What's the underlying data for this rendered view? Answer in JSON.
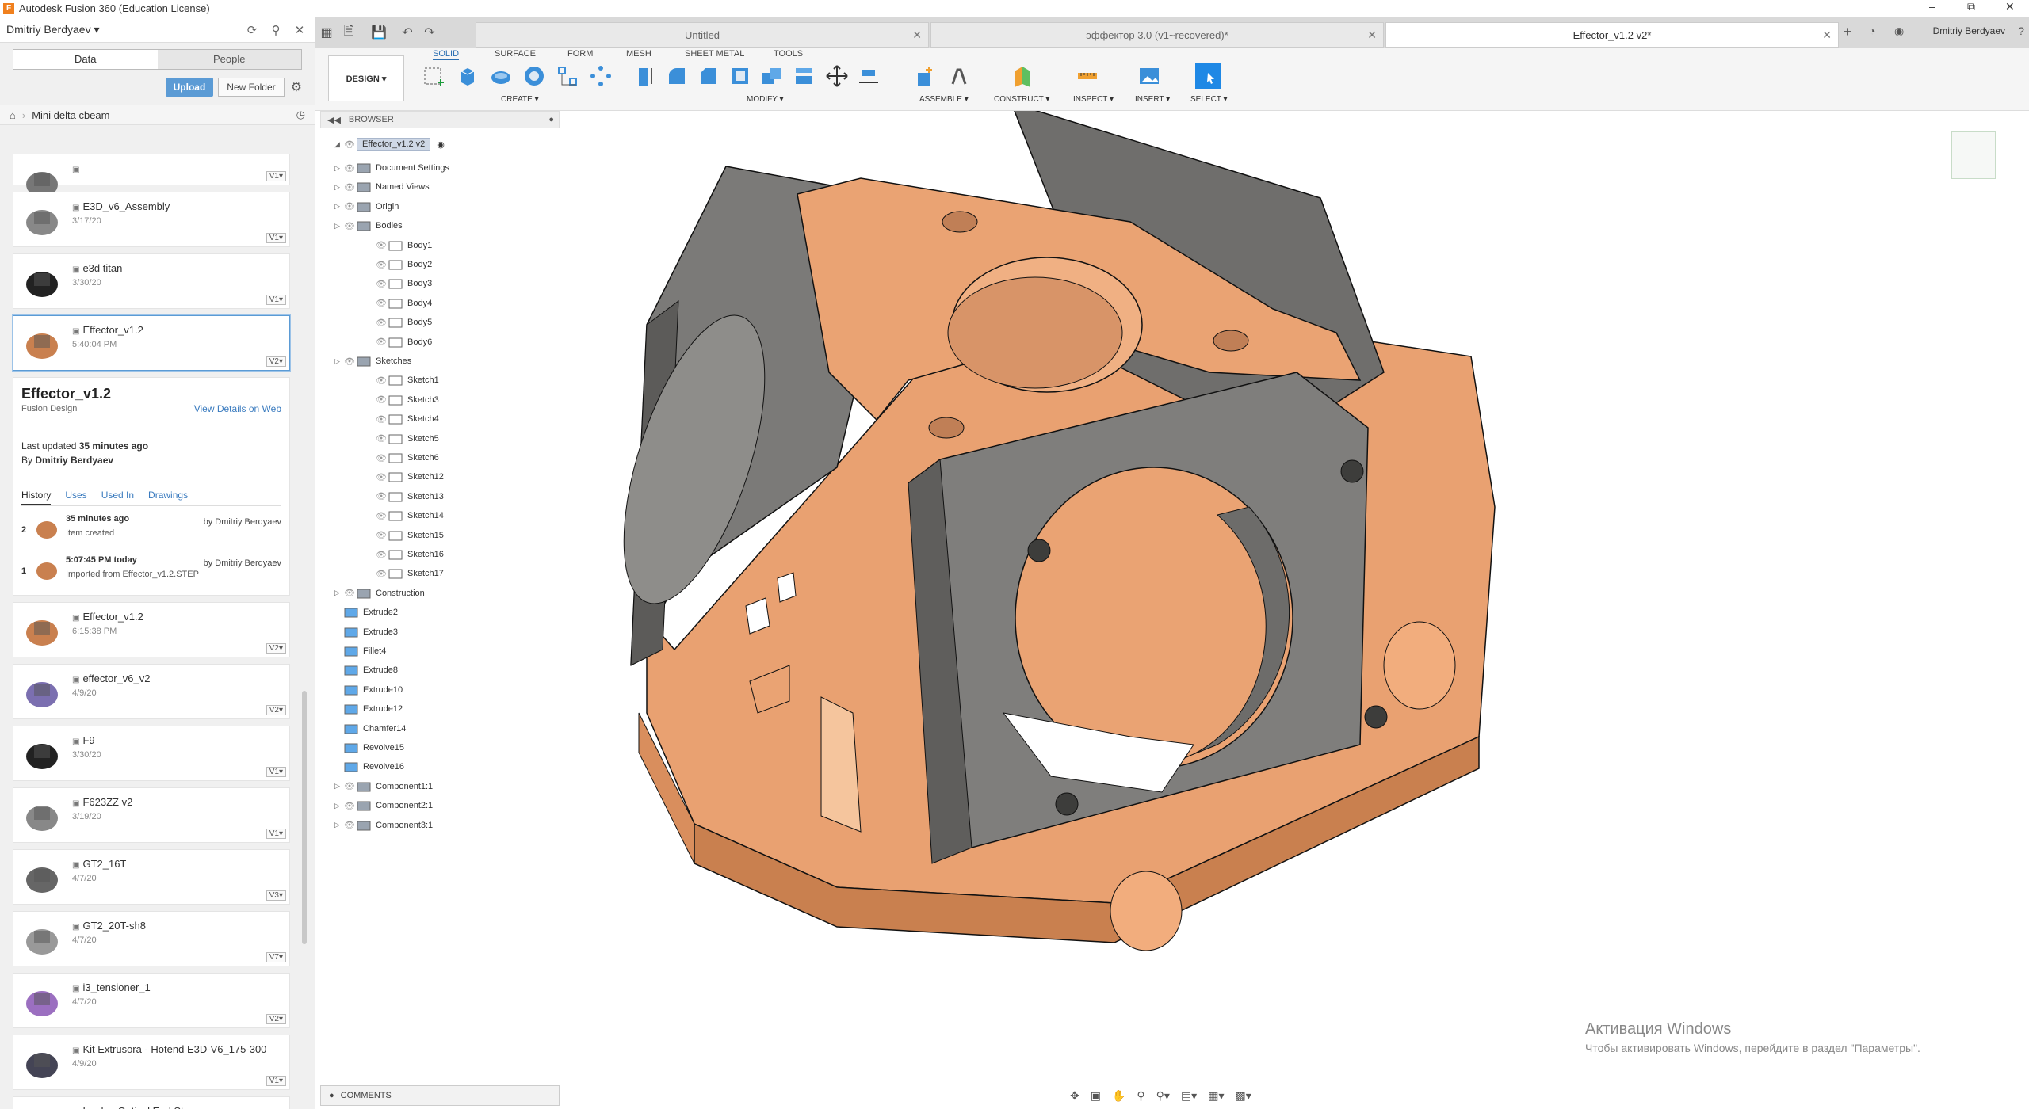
{
  "window": {
    "title": "Autodesk Fusion 360 (Education License)"
  },
  "datapanel": {
    "user": "Dmitriy Berdyaev",
    "tab_data": "Data",
    "tab_people": "People",
    "upload": "Upload",
    "new_folder": "New Folder",
    "breadcrumb": "Mini delta cbeam",
    "items_top": [
      {
        "name": "",
        "date": "",
        "ver": "V1▾"
      },
      {
        "name": "E3D_v6_Assembly",
        "date": "3/17/20",
        "ver": "V1▾"
      },
      {
        "name": "e3d titan",
        "date": "3/30/20",
        "ver": "V1▾"
      },
      {
        "name": "Effector_v1.2",
        "date": "5:40:04 PM",
        "ver": "V2▾"
      }
    ],
    "details": {
      "title": "Effector_v1.2",
      "type": "Fusion Design",
      "view_link": "View Details on Web",
      "last_updated_prefix": "Last updated ",
      "last_updated": "35 minutes ago",
      "by_prefix": "By ",
      "by": "Dmitriy Berdyaev",
      "tabs": [
        "History",
        "Uses",
        "Used In",
        "Drawings"
      ],
      "history": [
        {
          "num": "2",
          "when": "35 minutes ago",
          "who": "by Dmitriy Berdyaev",
          "what": "Item created"
        },
        {
          "num": "1",
          "when": "5:07:45 PM today",
          "who": "by Dmitriy Berdyaev",
          "what": "Imported from Effector_v1.2.STEP"
        }
      ]
    },
    "items_bottom": [
      {
        "name": "Effector_v1.2",
        "date": "6:15:38 PM",
        "ver": "V2▾"
      },
      {
        "name": "effector_v6_v2",
        "date": "4/9/20",
        "ver": "V2▾"
      },
      {
        "name": "F9",
        "date": "3/30/20",
        "ver": "V1▾"
      },
      {
        "name": "F623ZZ v2",
        "date": "3/19/20",
        "ver": "V1▾"
      },
      {
        "name": "GT2_16T",
        "date": "4/7/20",
        "ver": "V3▾"
      },
      {
        "name": "GT2_20T-sh8",
        "date": "4/7/20",
        "ver": "V7▾"
      },
      {
        "name": "i3_tensioner_1",
        "date": "4/7/20",
        "ver": "V2▾"
      },
      {
        "name": "Kit Extrusora - Hotend E3D-V6_175-300",
        "date": "4/9/20",
        "ver": "V1▾"
      },
      {
        "name": "Lerdge Optical End Stop",
        "date": "",
        "ver": ""
      }
    ]
  },
  "tabs": [
    {
      "label": "Untitled"
    },
    {
      "label": "эффектор 3.0 (v1~recovered)*"
    },
    {
      "label": "Effector_v1.2 v2*"
    }
  ],
  "account": "Dmitriy Berdyaev",
  "toolbar": {
    "workspace": "DESIGN ▾",
    "tabs": [
      "SOLID",
      "SURFACE",
      "FORM",
      "MESH",
      "SHEET METAL",
      "TOOLS"
    ],
    "groups": [
      "CREATE ▾",
      "MODIFY ▾",
      "ASSEMBLE ▾",
      "CONSTRUCT ▾",
      "INSPECT ▾",
      "INSERT ▾",
      "SELECT ▾"
    ]
  },
  "browser": {
    "title": "BROWSER",
    "root": "Effector_v1.2 v2",
    "nodes": [
      "Document Settings",
      "Named Views",
      "Origin",
      "Bodies",
      "Body1",
      "Body2",
      "Body3",
      "Body4",
      "Body5",
      "Body6",
      "Sketches",
      "Sketch1",
      "Sketch3",
      "Sketch4",
      "Sketch5",
      "Sketch6",
      "Sketch12",
      "Sketch13",
      "Sketch14",
      "Sketch15",
      "Sketch16",
      "Sketch17",
      "Construction",
      "Extrude2",
      "Extrude3",
      "Fillet4",
      "Extrude8",
      "Extrude10",
      "Extrude12",
      "Chamfer14",
      "Revolve15",
      "Revolve16",
      "Component1:1",
      "Component2:1",
      "Component3:1"
    ],
    "comments": "COMMENTS"
  },
  "watermark": {
    "line1": "Активация Windows",
    "line2": "Чтобы активировать Windows, перейдите в раздел \"Параметры\"."
  },
  "colors": {
    "part_orange": "#e8a070",
    "part_gray": "#7a7a78",
    "accent": "#2b6fb3"
  }
}
